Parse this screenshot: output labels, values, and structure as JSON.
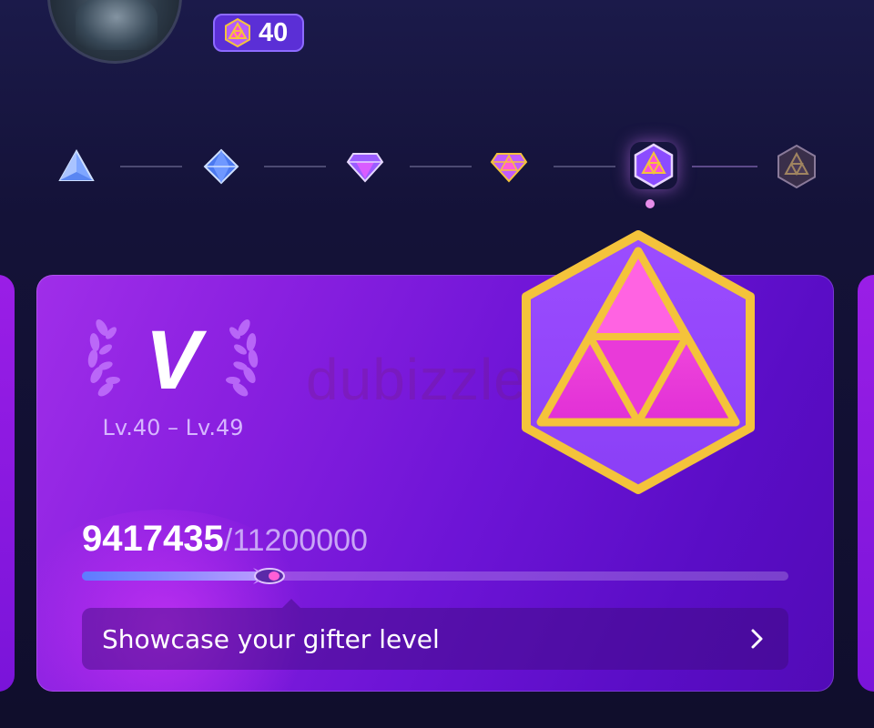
{
  "profile": {
    "level_value": "40"
  },
  "tiers": {
    "nodes": [
      {
        "icon": "blue-triangle-gem-icon"
      },
      {
        "icon": "blue-diamond-gem-icon"
      },
      {
        "icon": "purple-gem-icon"
      },
      {
        "icon": "pink-gold-gem-icon"
      },
      {
        "icon": "hexagon-gold-gem-icon-selected"
      },
      {
        "icon": "dark-hexagon-gem-icon-locked"
      }
    ],
    "selected_index": 4
  },
  "card": {
    "tier_letter": "V",
    "range_text": "Lv.40 – Lv.49",
    "watermark": "dubizzle",
    "progress": {
      "current": "9417435",
      "separator": "/",
      "max": "11200000",
      "fraction": 0.2536
    },
    "showcase_label": "Showcase your gifter level"
  },
  "colors": {
    "accent": "#8a20e0",
    "gold": "#f4c33b",
    "pink": "#e63ee0"
  }
}
